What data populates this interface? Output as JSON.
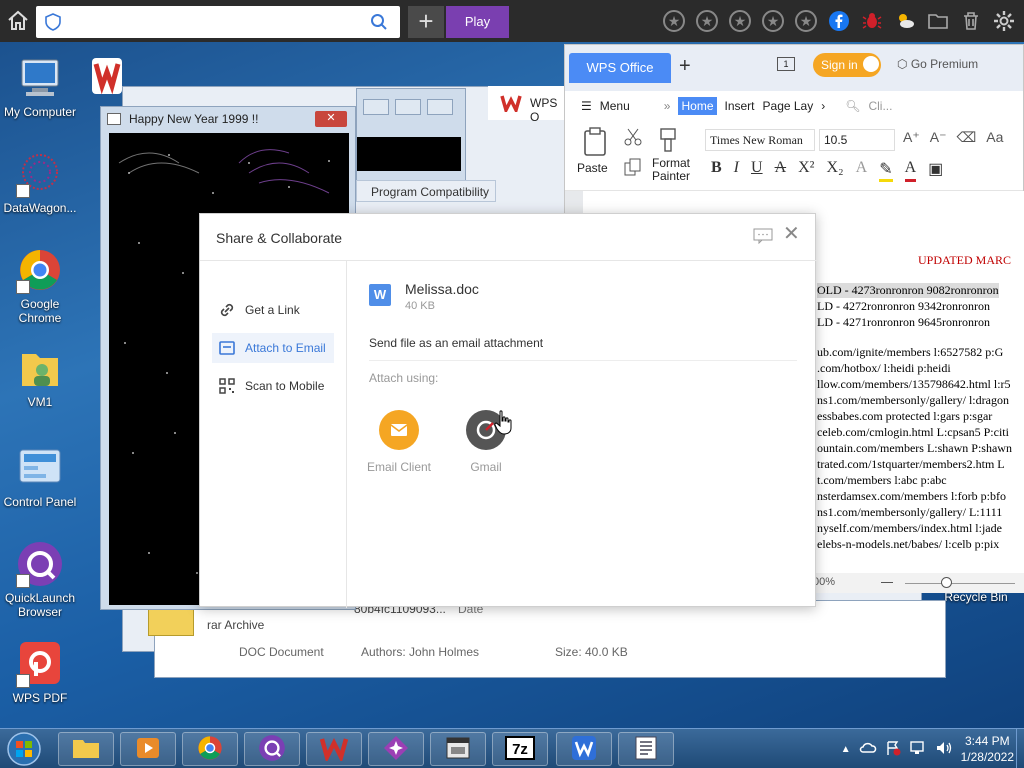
{
  "topbar": {
    "search_value": "",
    "plus_label": "+",
    "play_label": "Play",
    "icons": [
      "star-icon",
      "star-icon",
      "star-icon",
      "star-icon",
      "star-icon",
      "facebook-icon",
      "bug-icon",
      "weather-icon",
      "folder-icon",
      "trash-icon",
      "gear-icon"
    ]
  },
  "desktop": {
    "icons": [
      {
        "label": "My Computer"
      },
      {
        "label": "DataWagon..."
      },
      {
        "label": "Google Chrome"
      },
      {
        "label": "VM1"
      },
      {
        "label": "Control Panel"
      },
      {
        "label": "QuickLaunch Browser"
      },
      {
        "label": "WPS PDF"
      },
      {
        "label": "Recycle Bin"
      }
    ]
  },
  "background_windows": {
    "happy_new_year_title": "Happy New Year 1999 !!",
    "program_compat_title": "Program Compatibility",
    "archive_label": "rar Archive",
    "doc_label": "DOC Document",
    "authors_label": "Authors: John Holmes",
    "size_label": "Size: 40.0 KB",
    "partial_hash": "80b4fc1109093...",
    "partial_date": "Date"
  },
  "wps": {
    "tab_label": "WPS Office",
    "sign_in": "Sign in",
    "go_premium": "Go Premium",
    "behind_title": "WPS O",
    "menu_label": "Menu",
    "tabs": [
      "Home",
      "Insert",
      "Page Lay"
    ],
    "search_placeholder": "Cli...",
    "font_name": "Times New Roman",
    "font_size": "10.5",
    "paste_label": "Paste",
    "format_painter_label": "Format Painter",
    "zoom_text": "00%",
    "doc": {
      "heading": "UPDATED MARC",
      "lines": [
        "OLD - 4273ronronron 9082ronronron",
        "LD - 4272ronronron 9342ronronron",
        "LD - 4271ronronron 9645ronronron",
        "ub.com/ignite/members l:6527582 p:G",
        ".com/hotbox/ l:heidi p:heidi",
        "llow.com/members/135798642.html l:r5",
        "ns1.com/membersonly/gallery/ l:dragon",
        "essbabes.com protected l:gars p:sgar",
        "celeb.com/cmlogin.html L:cpsan5 P:citi",
        "ountain.com/members L:shawn P:shawn",
        "trated.com/1stquarter/members2.htm L",
        "t.com/members l:abc p:abc",
        "nsterdamsex.com/members l:forb p:bfo",
        "ns1.com/membersonly/gallery/ L:1111",
        "nyself.com/members/index.html l:jade",
        "elebs-n-models.net/babes/ l:celb p:pix"
      ]
    }
  },
  "dialog": {
    "title": "Share & Collaborate",
    "options": [
      {
        "label": "Get a Link",
        "active": false
      },
      {
        "label": "Attach to Email",
        "active": true
      },
      {
        "label": "Scan to Mobile",
        "active": false
      }
    ],
    "file_name": "Melissa.doc",
    "file_size": "40 KB",
    "send_text": "Send file as an email attachment",
    "attach_using": "Attach using:",
    "email_client": "Email Client",
    "gmail": "Gmail"
  },
  "taskbar": {
    "time": "3:44 PM",
    "date": "1/28/2022"
  },
  "colors": {
    "accent_blue": "#4b8bf5",
    "dialog_active": "#3a78d8",
    "play_purple": "#7a3fb0",
    "email_orange": "#f5a623",
    "gmail_dark": "#555555",
    "doc_heading_red": "#c00000"
  }
}
